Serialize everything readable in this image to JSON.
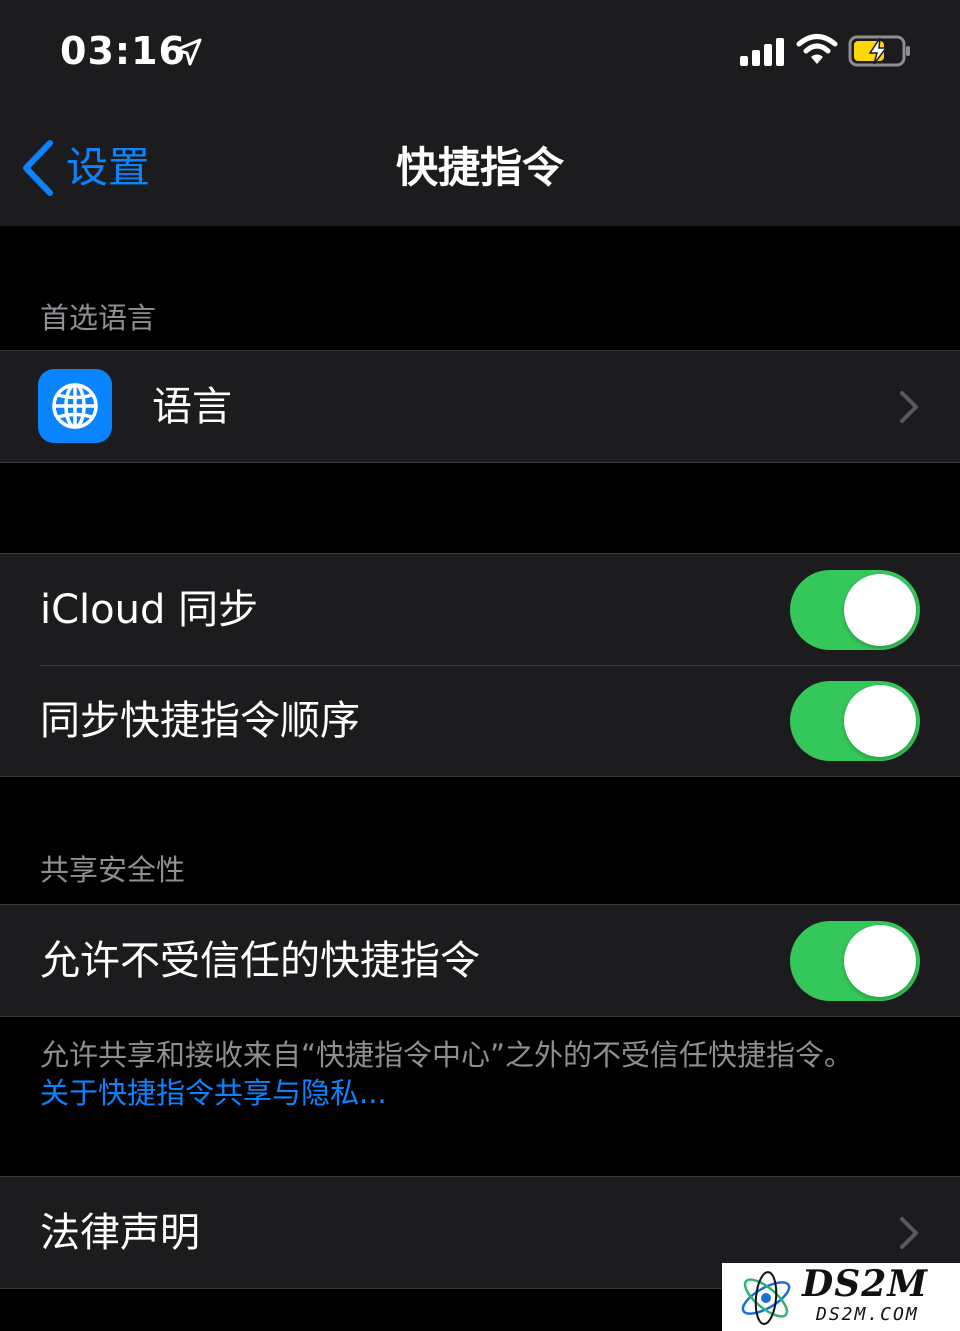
{
  "status_bar": {
    "time": "03:16",
    "icons": [
      "location-arrow-icon",
      "cellular-signal-icon",
      "wifi-icon",
      "battery-charging-icon"
    ]
  },
  "nav": {
    "back_label": "设置",
    "title": "快捷指令"
  },
  "sections": {
    "preferred_language": {
      "header": "首选语言",
      "rows": [
        {
          "label": "语言",
          "icon": "globe-icon"
        }
      ]
    },
    "sync": {
      "rows": [
        {
          "label": "iCloud 同步",
          "toggle_on": true
        },
        {
          "label": "同步快捷指令顺序",
          "toggle_on": true
        }
      ]
    },
    "sharing_security": {
      "header": "共享安全性",
      "rows": [
        {
          "label": "允许不受信任的快捷指令",
          "toggle_on": true
        }
      ],
      "footer_text": "允许共享和接收来自“快捷指令中心”之外的不受信任快捷指令。",
      "footer_link": "关于快捷指令共享与隐私..."
    },
    "legal": {
      "rows": [
        {
          "label": "法律声明"
        }
      ]
    }
  },
  "watermark": {
    "main": "DS2M",
    "sub": "DS2M.COM"
  },
  "colors": {
    "accent": "#0a84ff",
    "toggle_on": "#34c759",
    "battery_fill": "#ffd60a",
    "cell_background": "#1c1c1e",
    "page_background": "#000000"
  }
}
